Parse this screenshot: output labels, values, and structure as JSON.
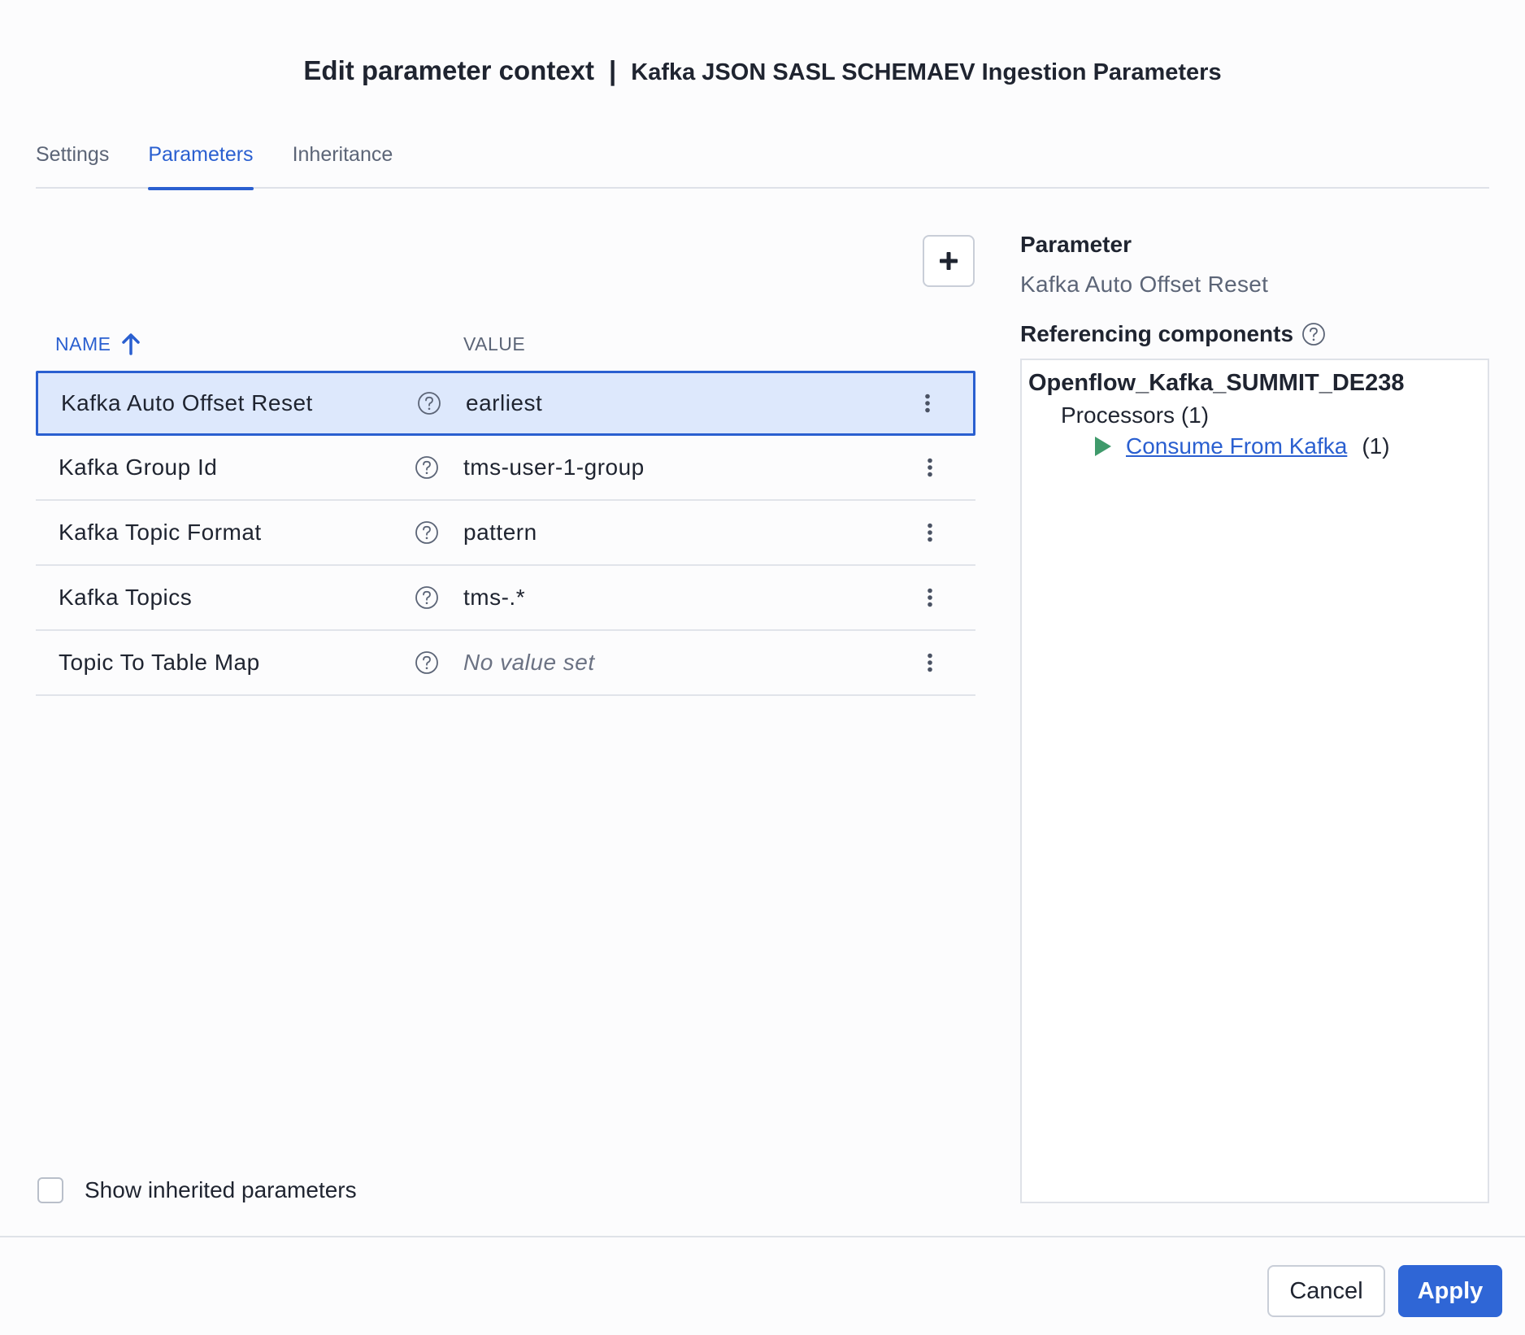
{
  "dialog": {
    "title": "Edit parameter context",
    "separator": "|",
    "subtitle": "Kafka JSON SASL SCHEMAEV Ingestion Parameters"
  },
  "tabs": [
    {
      "label": "Settings",
      "active": false
    },
    {
      "label": "Parameters",
      "active": true
    },
    {
      "label": "Inheritance",
      "active": false
    }
  ],
  "table": {
    "columns": {
      "name": "NAME",
      "value": "VALUE"
    },
    "sort": "name-ascending",
    "rows": [
      {
        "name": "Kafka Auto Offset Reset",
        "value": "earliest",
        "selected": true
      },
      {
        "name": "Kafka Group Id",
        "value": "tms-user-1-group"
      },
      {
        "name": "Kafka Topic Format",
        "value": "pattern"
      },
      {
        "name": "Kafka Topics",
        "value": "tms-.*"
      },
      {
        "name": "Topic To Table Map",
        "value": "No value set",
        "empty": true
      }
    ]
  },
  "show_inherited": {
    "label": "Show inherited parameters",
    "checked": false
  },
  "details": {
    "parameter_heading": "Parameter",
    "parameter_name": "Kafka Auto Offset Reset",
    "referencing_heading": "Referencing components",
    "group": "Openflow_Kafka_SUMMIT_DE238",
    "processors_label": "Processors (1)",
    "processor": {
      "name": "Consume From Kafka",
      "count": "(1)",
      "state_color": "#3f9a6b"
    }
  },
  "footer": {
    "cancel": "Cancel",
    "apply": "Apply"
  },
  "colors": {
    "accent": "#2a5fd0",
    "selected_row": "#dde8fc",
    "apply_button": "#2f66d6"
  }
}
